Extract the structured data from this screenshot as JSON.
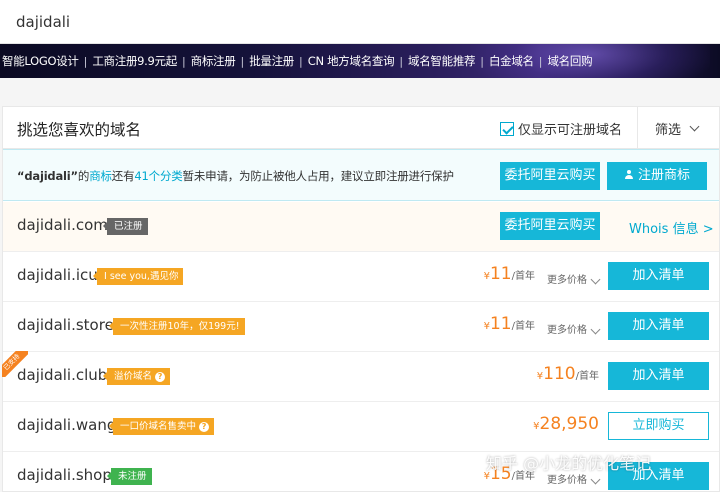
{
  "search": {
    "value": "dajidali"
  },
  "nav": {
    "items": [
      "智能LOGO设计",
      "工商注册9.9元起",
      "商标注册",
      "批量注册",
      "CN 地方域名查询",
      "域名智能推荐",
      "白金域名",
      "域名回购"
    ],
    "separator": "|"
  },
  "header": {
    "title": "挑选您喜欢的域名",
    "only_available": "仅显示可注册域名",
    "filter": "筛选"
  },
  "notice": {
    "query": "“dajidali”",
    "part1": "的",
    "link1": "商标",
    "part2": "还有",
    "link2": "41个分类",
    "part3": "暂未申请，为防止被他人占用，建议立即注册进行保护",
    "entrust_label": "委托阿里云购买",
    "trademark_label": "注册商标"
  },
  "rows": [
    {
      "domain": "dajidali.com",
      "badge": "已注册",
      "entrust_label": "委托阿里云购买",
      "whois_label": "Whois 信息 >"
    },
    {
      "domain": "dajidali.icu",
      "badge": "I see you,遇见你",
      "currency": "¥",
      "price": "11",
      "unit": "/首年",
      "more": "更多价格",
      "action": "加入清单"
    },
    {
      "domain": "dajidali.store",
      "badge": "一次性注册10年，仅199元!",
      "currency": "¥",
      "price": "11",
      "unit": "/首年",
      "more": "更多价格",
      "action": "加入清单"
    },
    {
      "domain": "dajidali.club",
      "ribbon": "已支持",
      "badge": "溢价域名",
      "currency": "¥",
      "price": "110",
      "unit": "/首年",
      "action": "加入清单"
    },
    {
      "domain": "dajidali.wang",
      "badge": "一口价域名售卖中",
      "currency": "¥",
      "price": "28,950",
      "action": "立即购买"
    },
    {
      "domain": "dajidali.shop",
      "badge": "未注册",
      "currency": "¥",
      "price": "15",
      "unit": "/首年",
      "more": "更多价格",
      "action": "加入清单"
    }
  ],
  "watermark": "知乎 @小龙的优化笔记",
  "colors": {
    "accent": "#16b7d8",
    "price": "#f58220",
    "badge_orange": "#f5a623",
    "badge_green": "#3fb34f",
    "badge_gray": "#666666"
  }
}
